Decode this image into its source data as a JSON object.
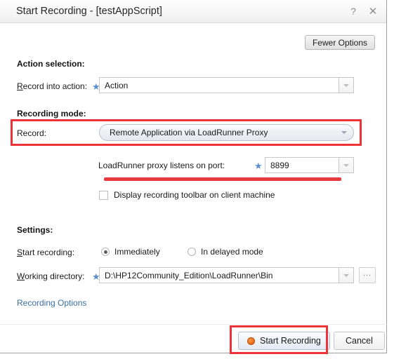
{
  "dialog": {
    "title": "Start Recording - [testAppScript]",
    "help_icon": "?",
    "close_icon": "✕",
    "fewer_options_label": "Fewer Options"
  },
  "action_selection": {
    "heading": "Action selection:",
    "record_into_action": {
      "label_accel": "R",
      "label_rest": "ecord into action:",
      "required_marker": "★",
      "value": "Action"
    }
  },
  "recording_mode": {
    "heading": "Recording mode:",
    "record": {
      "label": "Record:",
      "value": "Remote Application via LoadRunner Proxy"
    },
    "proxy_port": {
      "label": "LoadRunner proxy listens on port:",
      "required_marker": "★",
      "value": "8899"
    },
    "display_toolbar": {
      "label": "Display recording toolbar on client machine",
      "checked": false
    }
  },
  "settings": {
    "heading": "Settings:",
    "start_recording": {
      "label_accel": "S",
      "label_rest": "tart recording:",
      "option_immediately": "Immediately",
      "option_delayed": "In delayed mode",
      "selected": "Immediately"
    },
    "working_directory": {
      "label_accel": "W",
      "label_rest": "orking directory:",
      "required_marker": "★",
      "value": "D:\\HP12Community_Edition\\LoadRunner\\Bin",
      "browse_label": "..."
    }
  },
  "links": {
    "recording_options": "Recording Options"
  },
  "footer": {
    "start_recording_label": "Start Recording",
    "cancel_label": "Cancel"
  },
  "colors": {
    "annotation_red": "#ee3338",
    "link_blue": "#3a6ea5",
    "required_star_blue": "#5a8fd0",
    "record_dot_orange": "#ef7520"
  }
}
